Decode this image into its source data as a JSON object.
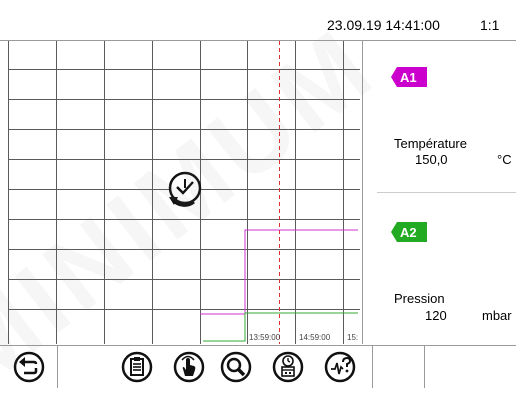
{
  "header": {
    "datetime": "23.09.19 14:41:00",
    "ratio": "1:1"
  },
  "chart": {
    "time_labels": [
      "13:59:00",
      "14:59:00",
      "15:"
    ]
  },
  "panel": {
    "channels": [
      {
        "tag": "A1",
        "color": "#cc00cc",
        "label": "Température",
        "value": "150,0",
        "unit": "°C"
      },
      {
        "tag": "A2",
        "color": "#22aa22",
        "label": "Pression",
        "value": "120",
        "unit": "mbar"
      }
    ]
  },
  "toolbar": {
    "buttons": [
      "back-icon",
      "clipboard-icon",
      "touch-icon",
      "search-icon",
      "calendar-clock-icon",
      "graph-help-icon"
    ]
  },
  "watermark": {
    "text": "MINIMUM"
  }
}
